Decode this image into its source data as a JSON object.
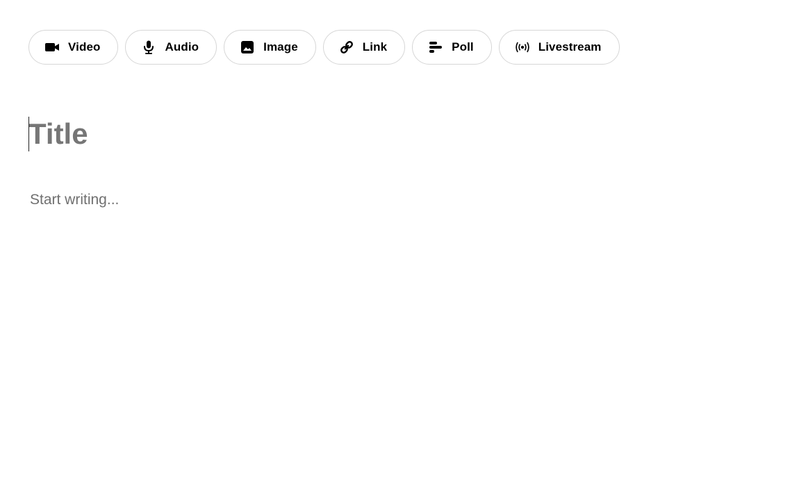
{
  "toolbar": {
    "buttons": [
      {
        "label": "Video",
        "icon": "video-camera-icon"
      },
      {
        "label": "Audio",
        "icon": "microphone-icon"
      },
      {
        "label": "Image",
        "icon": "image-icon"
      },
      {
        "label": "Link",
        "icon": "link-icon"
      },
      {
        "label": "Poll",
        "icon": "poll-bars-icon"
      },
      {
        "label": "Livestream",
        "icon": "broadcast-icon"
      }
    ]
  },
  "editor": {
    "title_value": "",
    "title_placeholder": "Title",
    "body_value": "",
    "body_placeholder": "Start writing..."
  },
  "colors": {
    "chip_border": "#d6d6d6",
    "placeholder_title": "#767676",
    "placeholder_body": "#707070",
    "text": "#000000"
  }
}
